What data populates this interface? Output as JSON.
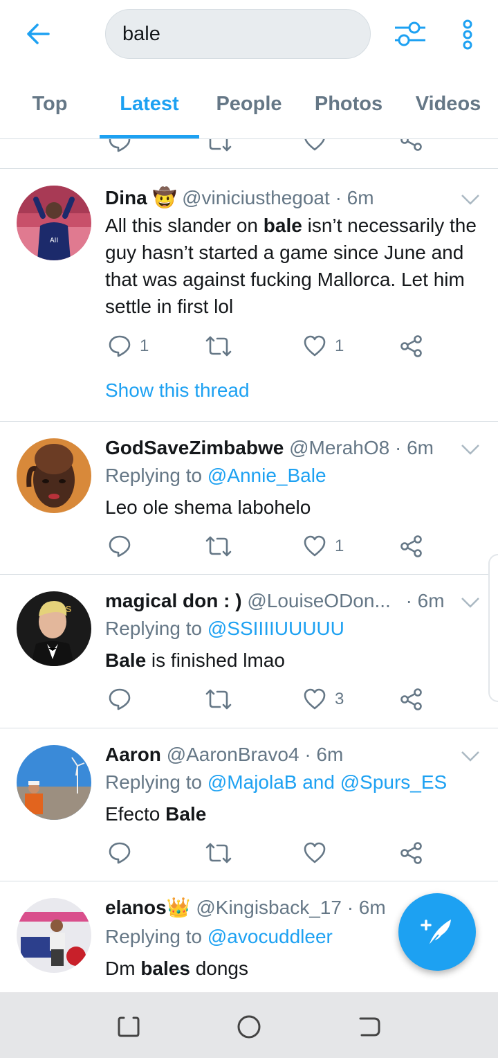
{
  "search": {
    "query": "bale"
  },
  "tabs": [
    {
      "label": "Top"
    },
    {
      "label": "Latest"
    },
    {
      "label": "People"
    },
    {
      "label": "Photos"
    },
    {
      "label": "Videos"
    }
  ],
  "active_tab": "Latest",
  "tweets": [
    {
      "name": "Dina",
      "emoji": "🤠",
      "handle": "@viniciusthegoat",
      "time": "· 6m",
      "body_pre": "All this slander on ",
      "body_bold": "bale",
      "body_post": " isn’t necessarily the guy hasn’t started a game since June and that was against fucking Mallorca. Let him settle in first lol",
      "reply_count": "1",
      "like_count": "1",
      "show_thread": "Show this thread"
    },
    {
      "name": "GodSaveZimbabwe",
      "handle": "@MerahO8",
      "time": "· 6m",
      "replying_prefix": "Replying to ",
      "replying_to": "@Annie_Bale",
      "body": "Leo ole shema labohelo",
      "like_count": "1"
    },
    {
      "name": "magical don : )",
      "handle": "@LouiseODon...",
      "time": "· 6m",
      "replying_prefix": "Replying to ",
      "replying_to": "@SSIIIIUUUUU",
      "body_bold": "Bale",
      "body_post": " is finished lmao",
      "like_count": "3"
    },
    {
      "name": "Aaron",
      "handle": "@AaronBravo4",
      "time": "· 6m",
      "replying_prefix": "Replying to ",
      "replying_to": "@MajolaB and @Spurs_ES",
      "body_pre": "Efecto ",
      "body_bold": "Bale"
    },
    {
      "name": "elanos",
      "emoji": "👑",
      "handle": "@Kingisback_17",
      "time": "· 6m",
      "replying_prefix": "Replying to ",
      "replying_to": "@avocuddleer",
      "body_pre": "Dm ",
      "body_bold": "bales",
      "body_post": " dongs"
    }
  ],
  "colors": {
    "accent": "#1da1f2",
    "secondary_text": "#657786",
    "divider": "#d6dde2"
  }
}
